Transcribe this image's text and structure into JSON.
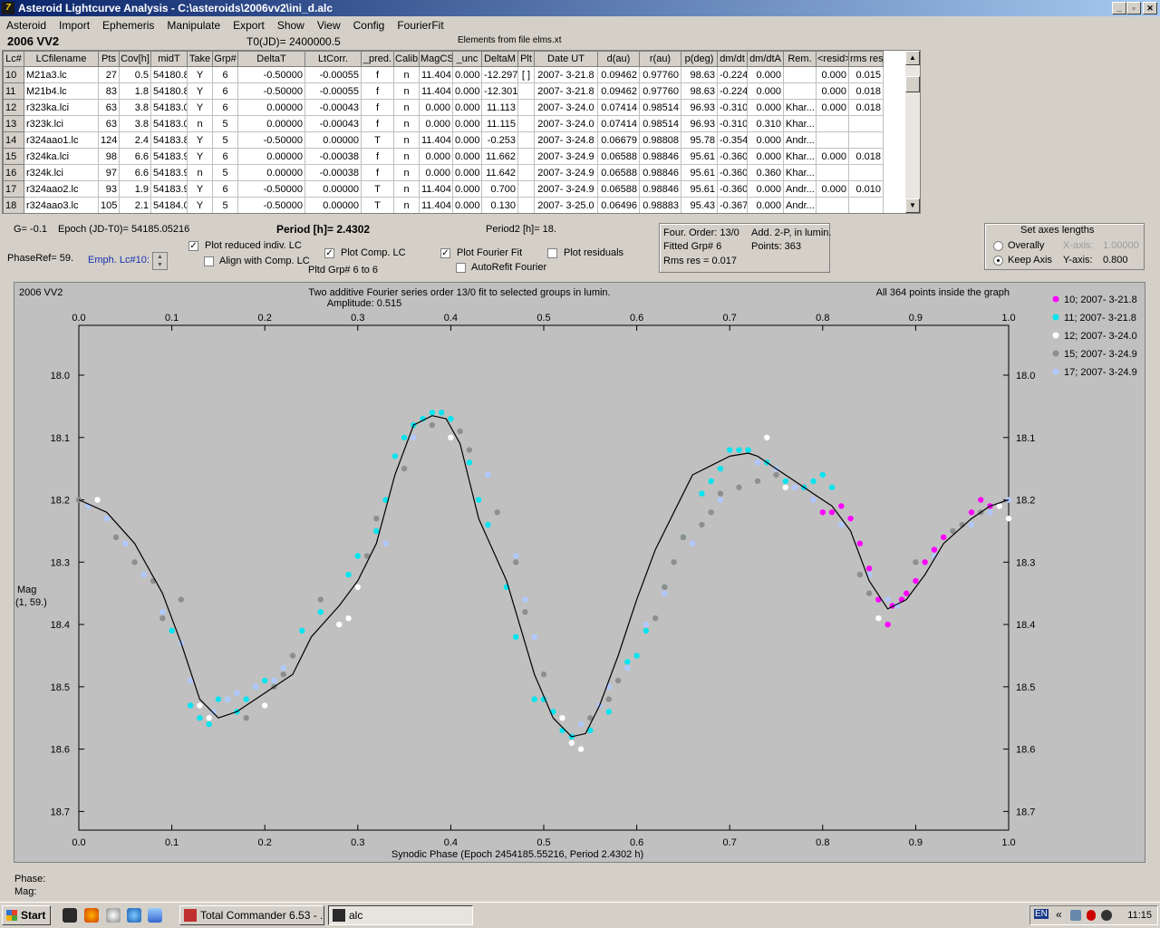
{
  "window": {
    "title": "Asteroid Lightcurve Analysis - C:\\asteroids\\2006vv2\\ini_d.alc",
    "icon": "7"
  },
  "menu": [
    "Asteroid",
    "Import",
    "Ephemeris",
    "Manipulate",
    "Export",
    "Show",
    "View",
    "Config",
    "FourierFit"
  ],
  "header": {
    "object": "2006 VV2",
    "t0": "T0(JD)= 2400000.5",
    "elements": "Elements from file elms.xt"
  },
  "table": {
    "columns": [
      "Lc#",
      "LCfilename",
      "Pts",
      "Cov[h]",
      "midT",
      "Take",
      "Grp#",
      "DeltaT",
      "LtCorr.",
      "_pred.",
      "Calib.",
      "MagCS",
      "_unc",
      "DeltaM",
      "Plt",
      "Date UT",
      "d(au)",
      "r(au)",
      "p(deg)",
      "dm/dt",
      "dm/dtA",
      "Rem.",
      "<resid>",
      "rms res"
    ],
    "rows": [
      [
        "10",
        "M21a3.lc",
        "27",
        "0.5",
        "54180.8",
        "Y",
        "6",
        "-0.50000",
        "-0.00055",
        "f",
        "n",
        "11.404",
        "0.000",
        "-12.297",
        "[ ]",
        "2007- 3-21.8",
        "0.09462",
        "0.97760",
        "98.63",
        "-0.224",
        "0.000",
        "",
        "0.000",
        "0.015"
      ],
      [
        "11",
        "M21b4.lc",
        "83",
        "1.8",
        "54180.8",
        "Y",
        "6",
        "-0.50000",
        "-0.00055",
        "f",
        "n",
        "11.404",
        "0.000",
        "-12.301",
        "",
        "2007- 3-21.8",
        "0.09462",
        "0.97760",
        "98.63",
        "-0.224",
        "0.000",
        "",
        "0.000",
        "0.018"
      ],
      [
        "12",
        "r323ka.lci",
        "63",
        "3.8",
        "54183.0",
        "Y",
        "6",
        "0.00000",
        "-0.00043",
        "f",
        "n",
        "0.000",
        "0.000",
        "11.113",
        "",
        "2007- 3-24.0",
        "0.07414",
        "0.98514",
        "96.93",
        "-0.310",
        "0.000",
        "Khar...",
        "0.000",
        "0.018"
      ],
      [
        "13",
        "r323k.lci",
        "63",
        "3.8",
        "54183.0",
        "n",
        "5",
        "0.00000",
        "-0.00043",
        "f",
        "n",
        "0.000",
        "0.000",
        "11.115",
        "",
        "2007- 3-24.0",
        "0.07414",
        "0.98514",
        "96.93",
        "-0.310",
        "0.310",
        "Khar...",
        "",
        ""
      ],
      [
        "14",
        "r324aao1.lc",
        "124",
        "2.4",
        "54183.8",
        "Y",
        "5",
        "-0.50000",
        "0.00000",
        "T",
        "n",
        "11.404",
        "0.000",
        "-0.253",
        "",
        "2007- 3-24.8",
        "0.06679",
        "0.98808",
        "95.78",
        "-0.354",
        "0.000",
        "Andr...",
        "",
        ""
      ],
      [
        "15",
        "r324ka.lci",
        "98",
        "6.6",
        "54183.9",
        "Y",
        "6",
        "0.00000",
        "-0.00038",
        "f",
        "n",
        "0.000",
        "0.000",
        "11.662",
        "",
        "2007- 3-24.9",
        "0.06588",
        "0.98846",
        "95.61",
        "-0.360",
        "0.000",
        "Khar...",
        "0.000",
        "0.018"
      ],
      [
        "16",
        "r324k.lci",
        "97",
        "6.6",
        "54183.9",
        "n",
        "5",
        "0.00000",
        "-0.00038",
        "f",
        "n",
        "0.000",
        "0.000",
        "11.642",
        "",
        "2007- 3-24.9",
        "0.06588",
        "0.98846",
        "95.61",
        "-0.360",
        "0.360",
        "Khar...",
        "",
        ""
      ],
      [
        "17",
        "r324aao2.lc",
        "93",
        "1.9",
        "54183.9",
        "Y",
        "6",
        "-0.50000",
        "0.00000",
        "T",
        "n",
        "11.404",
        "0.000",
        "0.700",
        "",
        "2007- 3-24.9",
        "0.06588",
        "0.98846",
        "95.61",
        "-0.360",
        "0.000",
        "Andr...",
        "0.000",
        "0.010"
      ],
      [
        "18",
        "r324aao3.lc",
        "105",
        "2.1",
        "54184.0",
        "Y",
        "5",
        "-0.50000",
        "0.00000",
        "T",
        "n",
        "11.404",
        "0.000",
        "0.130",
        "",
        "2007- 3-25.0",
        "0.06496",
        "0.98883",
        "95.43",
        "-0.367",
        "0.000",
        "Andr...",
        "",
        ""
      ]
    ]
  },
  "controls": {
    "g": "G= -0.1",
    "epoch": "Epoch (JD-T0)= 54185.05216",
    "period": "Period [h]= 2.4302",
    "period2": "Period2 [h]= 18.",
    "phaseref": "PhaseRef= 59.",
    "emph": "Emph. Lc#10:",
    "plot_reduced": "Plot reduced indiv. LC",
    "align_comp": "Align with Comp. LC",
    "plot_comp": "Plot Comp. LC",
    "plot_fourier": "Plot Fourier Fit",
    "plot_residuals": "Plot residuals",
    "autorefit": "AutoRefit Fourier",
    "pltd_grp": "Pltd Grp#  6   to    6",
    "fourier_info": [
      "Four. Order: 13/0",
      "Fitted Grp# 6",
      "Rms res      = 0.017",
      "Add. 2-P, in lumin.",
      "Points: 363"
    ],
    "axes_title": "Set axes lengths",
    "overally": "Overally",
    "keep_axis": "Keep Axis",
    "x_axis_label": "X-axis:",
    "x_axis_value": "1.00000",
    "y_axis_label": "Y-axis:",
    "y_axis_value": "0.800",
    "checks": {
      "plot_reduced": true,
      "align_comp": false,
      "plot_comp": true,
      "plot_fourier": true,
      "plot_residuals": false,
      "autorefit": false
    },
    "check_glyph": "✓"
  },
  "chart_data": {
    "type": "scatter",
    "object_label": "2006 VV2",
    "title": "Two additive Fourier series order 13/0 fit to selected groups in lumin.",
    "amplitude": "Amplitude: 0.515",
    "status": "All 364 points inside the graph",
    "xlabel": "Synodic Phase (Epoch 2454185.55216, Period 2.4302 h)",
    "ylabel": "Mag",
    "ylabel2": "(1, 59.)",
    "xlim": [
      0.0,
      1.0
    ],
    "ylim": [
      18.73,
      17.92
    ],
    "x_ticks": [
      "0.0",
      "0.1",
      "0.2",
      "0.3",
      "0.4",
      "0.5",
      "0.6",
      "0.7",
      "0.8",
      "0.9",
      "1.0"
    ],
    "y_ticks": [
      "18.0",
      "18.1",
      "18.2",
      "18.3",
      "18.4",
      "18.5",
      "18.6",
      "18.7"
    ],
    "legend_position": "top-right",
    "fit_curve": {
      "color": "#000000",
      "x": [
        0.0,
        0.03,
        0.06,
        0.09,
        0.11,
        0.13,
        0.15,
        0.17,
        0.2,
        0.23,
        0.25,
        0.28,
        0.3,
        0.32,
        0.34,
        0.36,
        0.38,
        0.395,
        0.41,
        0.43,
        0.46,
        0.49,
        0.51,
        0.53,
        0.545,
        0.56,
        0.58,
        0.6,
        0.62,
        0.64,
        0.66,
        0.68,
        0.7,
        0.72,
        0.73,
        0.75,
        0.77,
        0.79,
        0.81,
        0.83,
        0.85,
        0.87,
        0.89,
        0.91,
        0.93,
        0.96,
        0.98,
        1.0
      ],
      "y": [
        18.2,
        18.22,
        18.27,
        18.35,
        18.43,
        18.52,
        18.55,
        18.54,
        18.51,
        18.48,
        18.42,
        18.37,
        18.33,
        18.27,
        18.16,
        18.08,
        18.065,
        18.07,
        18.11,
        18.23,
        18.33,
        18.48,
        18.55,
        18.58,
        18.575,
        18.53,
        18.45,
        18.36,
        18.28,
        18.22,
        18.16,
        18.145,
        18.13,
        18.125,
        18.13,
        18.15,
        18.17,
        18.19,
        18.21,
        18.25,
        18.33,
        18.375,
        18.36,
        18.32,
        18.27,
        18.23,
        18.21,
        18.2
      ]
    },
    "series": [
      {
        "name": "10; 2007- 3-21.8",
        "color": "#ff00ff",
        "x": [
          0.78,
          0.79,
          0.8,
          0.81,
          0.82,
          0.83,
          0.84,
          0.85,
          0.86,
          0.87,
          0.875,
          0.885,
          0.89,
          0.9,
          0.91,
          0.92,
          0.93,
          0.96,
          0.97,
          0.98
        ],
        "y": [
          18.18,
          18.2,
          18.22,
          18.22,
          18.21,
          18.23,
          18.27,
          18.31,
          18.36,
          18.4,
          18.37,
          18.36,
          18.35,
          18.33,
          18.3,
          18.28,
          18.26,
          18.22,
          18.2,
          18.21
        ]
      },
      {
        "name": "11; 2007- 3-21.8",
        "color": "#00e5f0",
        "x": [
          0.1,
          0.12,
          0.13,
          0.14,
          0.15,
          0.16,
          0.17,
          0.18,
          0.19,
          0.2,
          0.21,
          0.24,
          0.26,
          0.29,
          0.3,
          0.32,
          0.33,
          0.34,
          0.35,
          0.36,
          0.37,
          0.38,
          0.39,
          0.4,
          0.42,
          0.43,
          0.44,
          0.46,
          0.47,
          0.49,
          0.5,
          0.51,
          0.52,
          0.53,
          0.55,
          0.57,
          0.59,
          0.6,
          0.61,
          0.63,
          0.65,
          0.67,
          0.68,
          0.69,
          0.7,
          0.71,
          0.72,
          0.74,
          0.76,
          0.78,
          0.79,
          0.8,
          0.81
        ],
        "y": [
          18.41,
          18.53,
          18.55,
          18.56,
          18.52,
          18.52,
          18.54,
          18.52,
          18.5,
          18.49,
          18.49,
          18.41,
          18.38,
          18.32,
          18.29,
          18.25,
          18.2,
          18.13,
          18.1,
          18.08,
          18.07,
          18.06,
          18.06,
          18.07,
          18.14,
          18.2,
          18.24,
          18.34,
          18.42,
          18.52,
          18.52,
          18.54,
          18.57,
          18.58,
          18.57,
          18.54,
          18.46,
          18.45,
          18.41,
          18.34,
          18.26,
          18.19,
          18.17,
          18.15,
          18.12,
          18.12,
          18.12,
          18.14,
          18.17,
          18.18,
          18.17,
          18.16,
          18.18
        ]
      },
      {
        "name": "12; 2007- 3-24.0",
        "color": "#ffffff",
        "x": [
          0.02,
          0.13,
          0.14,
          0.16,
          0.2,
          0.28,
          0.29,
          0.3,
          0.4,
          0.52,
          0.53,
          0.54,
          0.74,
          0.76,
          0.86,
          0.99,
          1.0
        ],
        "y": [
          18.2,
          18.53,
          18.55,
          18.52,
          18.53,
          18.4,
          18.39,
          18.34,
          18.1,
          18.55,
          18.59,
          18.6,
          18.1,
          18.18,
          18.39,
          18.21,
          18.23
        ]
      },
      {
        "name": "15; 2007- 3-24.9",
        "color": "#8e8e8e",
        "x": [
          0.0,
          0.04,
          0.06,
          0.08,
          0.09,
          0.11,
          0.18,
          0.21,
          0.22,
          0.23,
          0.26,
          0.31,
          0.32,
          0.35,
          0.38,
          0.41,
          0.42,
          0.45,
          0.47,
          0.48,
          0.5,
          0.55,
          0.56,
          0.57,
          0.58,
          0.62,
          0.63,
          0.64,
          0.65,
          0.67,
          0.68,
          0.69,
          0.71,
          0.73,
          0.75,
          0.84,
          0.85,
          0.9,
          0.94,
          0.95,
          0.97
        ],
        "y": [
          18.2,
          18.26,
          18.3,
          18.33,
          18.39,
          18.36,
          18.55,
          18.5,
          18.48,
          18.45,
          18.36,
          18.29,
          18.23,
          18.15,
          18.08,
          18.09,
          18.12,
          18.22,
          18.3,
          18.38,
          18.48,
          18.55,
          18.53,
          18.52,
          18.49,
          18.39,
          18.34,
          18.3,
          18.26,
          18.24,
          18.22,
          18.19,
          18.18,
          18.17,
          18.16,
          18.32,
          18.35,
          18.3,
          18.25,
          18.24,
          18.22
        ]
      },
      {
        "name": "17; 2007- 3-24.9",
        "color": "#b0c8ff",
        "x": [
          0.01,
          0.03,
          0.05,
          0.07,
          0.09,
          0.11,
          0.12,
          0.145,
          0.16,
          0.17,
          0.19,
          0.21,
          0.22,
          0.33,
          0.36,
          0.44,
          0.47,
          0.48,
          0.49,
          0.54,
          0.56,
          0.57,
          0.59,
          0.61,
          0.63,
          0.66,
          0.69,
          0.73,
          0.75,
          0.77,
          0.79,
          0.82,
          0.85,
          0.87,
          0.88,
          0.92,
          0.96,
          0.98,
          1.0
        ],
        "y": [
          18.21,
          18.23,
          18.27,
          18.32,
          18.38,
          18.43,
          18.49,
          18.54,
          18.52,
          18.51,
          18.5,
          18.49,
          18.47,
          18.27,
          18.1,
          18.16,
          18.29,
          18.36,
          18.42,
          18.56,
          18.53,
          18.5,
          18.47,
          18.4,
          18.35,
          18.27,
          18.2,
          18.14,
          18.15,
          18.18,
          18.2,
          18.24,
          18.32,
          18.36,
          18.37,
          18.29,
          18.24,
          18.22,
          18.2
        ]
      }
    ]
  },
  "status": {
    "phase_label": "Phase:",
    "mag_label": "Mag:"
  },
  "taskbar": {
    "start": "Start",
    "tasks": [
      "Total Commander 6.53 - ...",
      "alc"
    ],
    "tray_lang": "EN",
    "clock": "11:15"
  }
}
